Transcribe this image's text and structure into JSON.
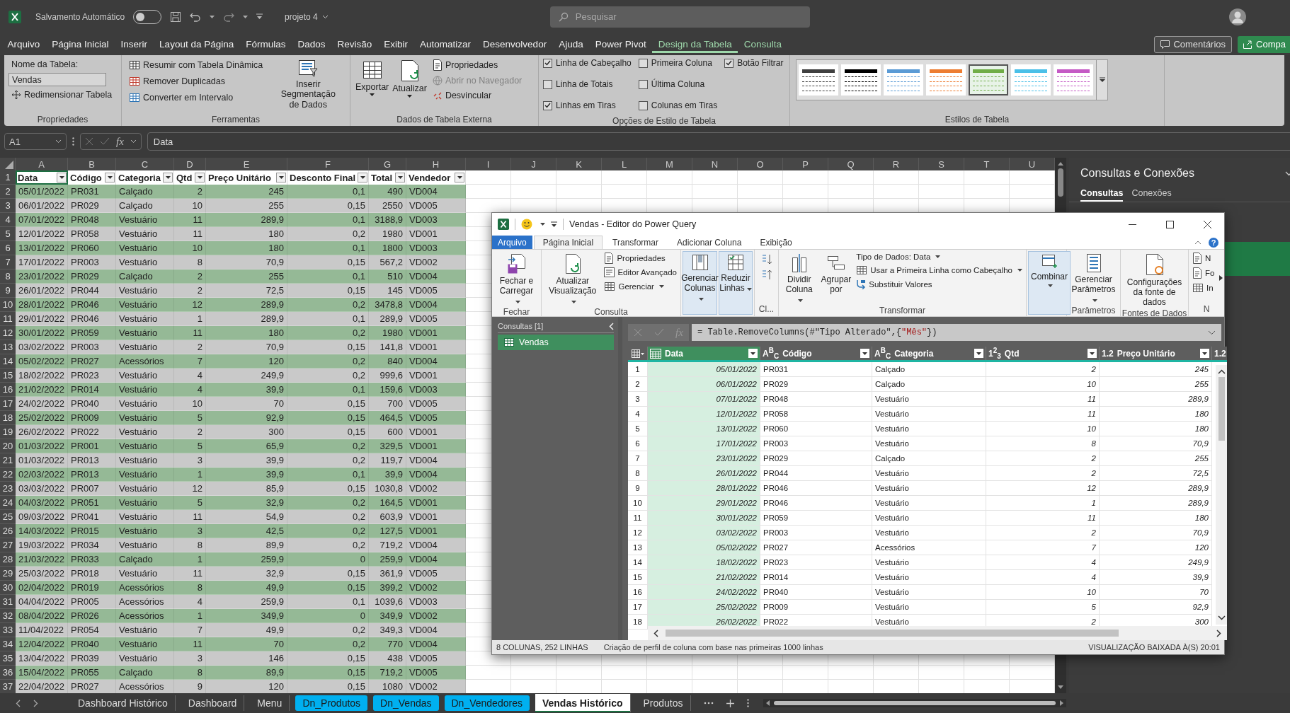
{
  "titlebar": {
    "autosave_label": "Salvamento Automático",
    "autosave_on": false,
    "file_name": "projeto 4",
    "search_placeholder": "Pesquisar"
  },
  "menu_tabs": [
    {
      "label": "Arquivo",
      "selected": false,
      "kind": "normal"
    },
    {
      "label": "Página Inicial",
      "selected": false,
      "kind": "normal"
    },
    {
      "label": "Inserir",
      "selected": false,
      "kind": "normal"
    },
    {
      "label": "Layout da Página",
      "selected": false,
      "kind": "normal"
    },
    {
      "label": "Fórmulas",
      "selected": false,
      "kind": "normal"
    },
    {
      "label": "Dados",
      "selected": false,
      "kind": "normal"
    },
    {
      "label": "Revisão",
      "selected": false,
      "kind": "normal"
    },
    {
      "label": "Exibir",
      "selected": false,
      "kind": "normal"
    },
    {
      "label": "Automatizar",
      "selected": false,
      "kind": "normal"
    },
    {
      "label": "Desenvolvedor",
      "selected": false,
      "kind": "normal"
    },
    {
      "label": "Ajuda",
      "selected": false,
      "kind": "normal"
    },
    {
      "label": "Power Pivot",
      "selected": false,
      "kind": "normal"
    },
    {
      "label": "Design da Tabela",
      "selected": true,
      "kind": "contextual"
    },
    {
      "label": "Consulta",
      "selected": false,
      "kind": "contextual"
    }
  ],
  "menu_buttons": [
    {
      "label": "Comentários",
      "kind": "outline"
    },
    {
      "label": "Compa",
      "kind": "primary"
    }
  ],
  "ribbon": {
    "properties": {
      "label": "Propriedades",
      "name_label": "Nome da Tabela:",
      "name_value": "Vendas",
      "resize": "Redimensionar Tabela"
    },
    "tools": {
      "label": "Ferramentas",
      "items": [
        "Resumir com Tabela Dinâmica",
        "Remover Duplicadas",
        "Converter em Intervalo"
      ],
      "slicer": "Inserir Segmentação de Dados"
    },
    "external": {
      "label": "Dados de Tabela Externa",
      "export": "Exportar",
      "refresh": "Atualizar",
      "items": [
        {
          "label": "Propriedades",
          "disabled": false
        },
        {
          "label": "Abrir no Navegador",
          "disabled": true
        },
        {
          "label": "Desvincular",
          "disabled": false
        }
      ]
    },
    "style_options": {
      "label": "Opções de Estilo de Tabela",
      "options": [
        {
          "label": "Linha de Cabeçalho",
          "checked": true
        },
        {
          "label": "Linha de Totais",
          "checked": false
        },
        {
          "label": "Linhas em Tiras",
          "checked": true
        },
        {
          "label": "Primeira Coluna",
          "checked": false
        },
        {
          "label": "Última Coluna",
          "checked": false
        },
        {
          "label": "Colunas em Tiras",
          "checked": false
        },
        {
          "label": "Botão Filtrar",
          "checked": true
        }
      ]
    },
    "styles": {
      "label": "Estilos de Tabela",
      "swatches": [
        {
          "color": "#404040",
          "selected": false
        },
        {
          "color": "#000000",
          "selected": false
        },
        {
          "color": "#5b9bd5",
          "selected": false
        },
        {
          "color": "#ed7d31",
          "selected": false
        },
        {
          "color": "#70ad47",
          "selected": true
        },
        {
          "color": "#4bc0e8",
          "selected": false
        },
        {
          "color": "#c55ac5",
          "selected": false
        }
      ]
    }
  },
  "formula_bar": {
    "name_box": "A1",
    "fx": "fx",
    "value": "Data"
  },
  "sheet": {
    "column_letters": [
      "A",
      "B",
      "C",
      "D",
      "E",
      "F",
      "G",
      "H",
      "I",
      "J",
      "K",
      "L",
      "M",
      "N",
      "O",
      "P",
      "Q",
      "R",
      "S",
      "T",
      "U"
    ],
    "header_num": "1",
    "columns": [
      {
        "label": "Data",
        "kind": "text"
      },
      {
        "label": "Código",
        "kind": "text"
      },
      {
        "label": "Categoria",
        "kind": "text"
      },
      {
        "label": "Qtd",
        "kind": "number"
      },
      {
        "label": "Preço Unitário",
        "kind": "number"
      },
      {
        "label": "Desconto Final",
        "kind": "number"
      },
      {
        "label": "Total",
        "kind": "number"
      },
      {
        "label": "Vendedor",
        "kind": "text"
      }
    ],
    "rows": [
      {
        "num": "2",
        "cells": [
          "05/01/2022",
          "PR031",
          "Calçado",
          "2",
          "245",
          "0,1",
          "490",
          "VD004"
        ]
      },
      {
        "num": "3",
        "cells": [
          "06/01/2022",
          "PR029",
          "Calçado",
          "10",
          "255",
          "0,15",
          "2550",
          "VD005"
        ]
      },
      {
        "num": "4",
        "cells": [
          "07/01/2022",
          "PR048",
          "Vestuário",
          "11",
          "289,9",
          "0,1",
          "3188,9",
          "VD003"
        ]
      },
      {
        "num": "5",
        "cells": [
          "12/01/2022",
          "PR058",
          "Vestuário",
          "11",
          "180",
          "0,2",
          "1980",
          "VD001"
        ]
      },
      {
        "num": "6",
        "cells": [
          "13/01/2022",
          "PR060",
          "Vestuário",
          "10",
          "180",
          "0,1",
          "1800",
          "VD003"
        ]
      },
      {
        "num": "7",
        "cells": [
          "17/01/2022",
          "PR003",
          "Vestuário",
          "8",
          "70,9",
          "0,15",
          "567,2",
          "VD002"
        ]
      },
      {
        "num": "8",
        "cells": [
          "23/01/2022",
          "PR029",
          "Calçado",
          "2",
          "255",
          "0,1",
          "510",
          "VD004"
        ]
      },
      {
        "num": "9",
        "cells": [
          "26/01/2022",
          "PR044",
          "Vestuário",
          "2",
          "72,5",
          "0,15",
          "145",
          "VD005"
        ]
      },
      {
        "num": "10",
        "cells": [
          "28/01/2022",
          "PR046",
          "Vestuário",
          "12",
          "289,9",
          "0,2",
          "3478,8",
          "VD004"
        ]
      },
      {
        "num": "11",
        "cells": [
          "29/01/2022",
          "PR046",
          "Vestuário",
          "1",
          "289,9",
          "0,1",
          "289,9",
          "VD005"
        ]
      },
      {
        "num": "12",
        "cells": [
          "30/01/2022",
          "PR059",
          "Vestuário",
          "11",
          "180",
          "0,2",
          "1980",
          "VD001"
        ]
      },
      {
        "num": "13",
        "cells": [
          "03/02/2022",
          "PR003",
          "Vestuário",
          "2",
          "70,9",
          "0,15",
          "141,8",
          "VD001"
        ]
      },
      {
        "num": "14",
        "cells": [
          "05/02/2022",
          "PR027",
          "Acessórios",
          "7",
          "120",
          "0,2",
          "840",
          "VD004"
        ]
      },
      {
        "num": "15",
        "cells": [
          "18/02/2022",
          "PR023",
          "Vestuário",
          "4",
          "249,9",
          "0,2",
          "999,6",
          "VD001"
        ]
      },
      {
        "num": "16",
        "cells": [
          "21/02/2022",
          "PR014",
          "Vestuário",
          "4",
          "39,9",
          "0,1",
          "159,6",
          "VD003"
        ]
      },
      {
        "num": "17",
        "cells": [
          "24/02/2022",
          "PR040",
          "Vestuário",
          "10",
          "70",
          "0,15",
          "700",
          "VD005"
        ]
      },
      {
        "num": "18",
        "cells": [
          "25/02/2022",
          "PR009",
          "Vestuário",
          "5",
          "92,9",
          "0,15",
          "464,5",
          "VD005"
        ]
      },
      {
        "num": "19",
        "cells": [
          "26/02/2022",
          "PR022",
          "Vestuário",
          "2",
          "300",
          "0,15",
          "600",
          "VD001"
        ]
      },
      {
        "num": "20",
        "cells": [
          "01/03/2022",
          "PR001",
          "Vestuário",
          "5",
          "65,9",
          "0,2",
          "329,5",
          "VD001"
        ]
      },
      {
        "num": "21",
        "cells": [
          "01/03/2022",
          "PR013",
          "Vestuário",
          "3",
          "39,9",
          "0,2",
          "119,7",
          "VD004"
        ]
      },
      {
        "num": "22",
        "cells": [
          "02/03/2022",
          "PR013",
          "Vestuário",
          "1",
          "39,9",
          "0,1",
          "39,9",
          "VD004"
        ]
      },
      {
        "num": "23",
        "cells": [
          "03/03/2022",
          "PR007",
          "Vestuário",
          "12",
          "85,9",
          "0,15",
          "1030,8",
          "VD002"
        ]
      },
      {
        "num": "24",
        "cells": [
          "04/03/2022",
          "PR051",
          "Vestuário",
          "5",
          "32,9",
          "0,2",
          "164,5",
          "VD001"
        ]
      },
      {
        "num": "25",
        "cells": [
          "09/03/2022",
          "PR041",
          "Vestuário",
          "11",
          "54,9",
          "0,2",
          "603,9",
          "VD001"
        ]
      },
      {
        "num": "26",
        "cells": [
          "14/03/2022",
          "PR015",
          "Vestuário",
          "3",
          "42,5",
          "0,2",
          "127,5",
          "VD001"
        ]
      },
      {
        "num": "27",
        "cells": [
          "19/03/2022",
          "PR034",
          "Vestuário",
          "8",
          "89,9",
          "0,2",
          "719,2",
          "VD004"
        ]
      },
      {
        "num": "28",
        "cells": [
          "21/03/2022",
          "PR033",
          "Calçado",
          "1",
          "259,9",
          "0",
          "259,9",
          "VD004"
        ]
      },
      {
        "num": "29",
        "cells": [
          "25/03/2022",
          "PR018",
          "Vestuário",
          "11",
          "32,9",
          "0,15",
          "361,9",
          "VD005"
        ]
      },
      {
        "num": "30",
        "cells": [
          "02/04/2022",
          "PR019",
          "Acessórios",
          "8",
          "49,9",
          "0,15",
          "399,2",
          "VD002"
        ]
      },
      {
        "num": "31",
        "cells": [
          "04/04/2022",
          "PR005",
          "Acessórios",
          "4",
          "259,9",
          "0,1",
          "1039,6",
          "VD003"
        ]
      },
      {
        "num": "32",
        "cells": [
          "08/04/2022",
          "PR026",
          "Acessórios",
          "1",
          "349,9",
          "0",
          "349,9",
          "VD002"
        ]
      },
      {
        "num": "33",
        "cells": [
          "11/04/2022",
          "PR054",
          "Vestuário",
          "7",
          "49,9",
          "0,2",
          "349,3",
          "VD004"
        ]
      },
      {
        "num": "34",
        "cells": [
          "12/04/2022",
          "PR040",
          "Vestuário",
          "11",
          "70",
          "0,2",
          "770",
          "VD004"
        ]
      },
      {
        "num": "35",
        "cells": [
          "13/04/2022",
          "PR039",
          "Vestuário",
          "3",
          "146",
          "0,15",
          "438",
          "VD005"
        ]
      },
      {
        "num": "36",
        "cells": [
          "15/04/2022",
          "PR055",
          "Calçado",
          "8",
          "89,9",
          "0,15",
          "719,2",
          "VD005"
        ]
      },
      {
        "num": "37",
        "cells": [
          "22/04/2022",
          "PR027",
          "Acessórios",
          "9",
          "120",
          "0,15",
          "1080",
          "VD002"
        ]
      }
    ]
  },
  "side_panel": {
    "title": "Consultas e Conexões",
    "tabs": [
      {
        "label": "Consultas",
        "selected": true
      },
      {
        "label": "Conexões",
        "selected": false
      }
    ]
  },
  "sheet_tabs": [
    {
      "label": "Dashboard Histórico",
      "selected": false
    },
    {
      "label": "Dashboard",
      "selected": false
    },
    {
      "label": "Menu",
      "selected": false
    },
    {
      "label": "Dn_Produtos",
      "selected": false,
      "color": "#00b0f0"
    },
    {
      "label": "Dn_Vendas",
      "selected": false,
      "color": "#00b0f0"
    },
    {
      "label": "Dn_Vendedores",
      "selected": false,
      "color": "#00b0f0"
    },
    {
      "label": "Vendas Histórico",
      "selected": true
    },
    {
      "label": "Produtos",
      "selected": false
    }
  ],
  "power_query": {
    "title": "Vendas - Editor do Power Query",
    "help": "?",
    "tabs": [
      {
        "label": "Arquivo",
        "selected": false,
        "kind": "file"
      },
      {
        "label": "Página Inicial",
        "selected": true,
        "kind": "normal"
      },
      {
        "label": "Transformar",
        "selected": false,
        "kind": "normal"
      },
      {
        "label": "Adicionar Coluna",
        "selected": false,
        "kind": "normal"
      },
      {
        "label": "Exibição",
        "selected": false,
        "kind": "normal"
      }
    ],
    "ribbon": {
      "close": {
        "label": "Fechar",
        "button": "Fechar e Carregar"
      },
      "query": {
        "label": "Consulta",
        "refresh": "Atualizar Visualização",
        "items": [
          "Propriedades",
          "Editor Avançado",
          "Gerenciar"
        ]
      },
      "manage": {
        "columns": "Gerenciar Colunas",
        "rows": "Reduzir Linhas"
      },
      "sort": {
        "label": "Cl..."
      },
      "transform": {
        "label": "Transformar",
        "split": "Dividir Coluna",
        "group": "Agrupar por",
        "items": [
          "Tipo de Dados: Data",
          "Usar a Primeira Linha como Cabeçalho",
          "Substituir Valores"
        ]
      },
      "combine": {
        "button": "Combinar"
      },
      "params": {
        "label": "Parâmetros",
        "button": "Gerenciar Parâmetros"
      },
      "sources": {
        "label": "Fontes de Dados",
        "button": "Configurações da fonte de dados"
      },
      "new": {
        "label": "N",
        "items": [
          "N",
          "Fo",
          "In"
        ]
      }
    },
    "queries": {
      "title": "Consultas [1]",
      "items": [
        {
          "label": "Vendas",
          "selected": true
        }
      ]
    },
    "formula": {
      "fx": "fx",
      "parts": [
        {
          "text": "= Table.RemoveColumns(#\"Tipo Alterado\",{",
          "kind": "code"
        },
        {
          "text": "\"Mês\"",
          "kind": "string"
        },
        {
          "text": "})",
          "kind": "code"
        }
      ]
    },
    "columns": [
      {
        "kind": "date",
        "label": "Data",
        "selected": true
      },
      {
        "kind": "text",
        "type_label": "A$^{B}$$_{C}$",
        "label": "Código",
        "selected": false
      },
      {
        "kind": "text",
        "type_label": "A$^{B}$$_{C}$",
        "label": "Categoria",
        "selected": false
      },
      {
        "kind": "number",
        "type_label": "1$^{2}$$_{3}$",
        "label": "Qtd",
        "selected": false
      },
      {
        "kind": "number",
        "type_label": "1.2",
        "label": "Preço Unitário",
        "selected": false
      },
      {
        "kind": "number",
        "type_label": "1.2",
        "selected": false
      }
    ],
    "rows": [
      {
        "num": "1",
        "cells": [
          "05/01/2022",
          "PR031",
          "Calçado",
          "2",
          "245"
        ]
      },
      {
        "num": "2",
        "cells": [
          "06/01/2022",
          "PR029",
          "Calçado",
          "10",
          "255"
        ]
      },
      {
        "num": "3",
        "cells": [
          "07/01/2022",
          "PR048",
          "Vestuário",
          "11",
          "289,9"
        ]
      },
      {
        "num": "4",
        "cells": [
          "12/01/2022",
          "PR058",
          "Vestuário",
          "11",
          "180"
        ]
      },
      {
        "num": "5",
        "cells": [
          "13/01/2022",
          "PR060",
          "Vestuário",
          "10",
          "180"
        ]
      },
      {
        "num": "6",
        "cells": [
          "17/01/2022",
          "PR003",
          "Vestuário",
          "8",
          "70,9"
        ]
      },
      {
        "num": "7",
        "cells": [
          "23/01/2022",
          "PR029",
          "Calçado",
          "2",
          "255"
        ]
      },
      {
        "num": "8",
        "cells": [
          "26/01/2022",
          "PR044",
          "Vestuário",
          "2",
          "72,5"
        ]
      },
      {
        "num": "9",
        "cells": [
          "28/01/2022",
          "PR046",
          "Vestuário",
          "12",
          "289,9"
        ]
      },
      {
        "num": "10",
        "cells": [
          "29/01/2022",
          "PR046",
          "Vestuário",
          "1",
          "289,9"
        ]
      },
      {
        "num": "11",
        "cells": [
          "30/01/2022",
          "PR059",
          "Vestuário",
          "11",
          "180"
        ]
      },
      {
        "num": "12",
        "cells": [
          "03/02/2022",
          "PR003",
          "Vestuário",
          "2",
          "70,9"
        ]
      },
      {
        "num": "13",
        "cells": [
          "05/02/2022",
          "PR027",
          "Acessórios",
          "7",
          "120"
        ]
      },
      {
        "num": "14",
        "cells": [
          "18/02/2022",
          "PR023",
          "Vestuário",
          "4",
          "249,9"
        ]
      },
      {
        "num": "15",
        "cells": [
          "21/02/2022",
          "PR014",
          "Vestuário",
          "4",
          "39,9"
        ]
      },
      {
        "num": "16",
        "cells": [
          "24/02/2022",
          "PR040",
          "Vestuário",
          "10",
          "70"
        ]
      },
      {
        "num": "17",
        "cells": [
          "25/02/2022",
          "PR009",
          "Vestuário",
          "5",
          "92,9"
        ]
      },
      {
        "num": "18",
        "cells": [
          "26/02/2022",
          "PR022",
          "Vestuário",
          "2",
          "300"
        ]
      }
    ],
    "status": {
      "counts": "8 COLUNAS, 252 LINHAS",
      "profile": "Criação de perfil de coluna com base nas primeiras 1000 linhas",
      "preview": "VISUALIZAÇÃO BAIXADA À(S) 20:01"
    }
  }
}
